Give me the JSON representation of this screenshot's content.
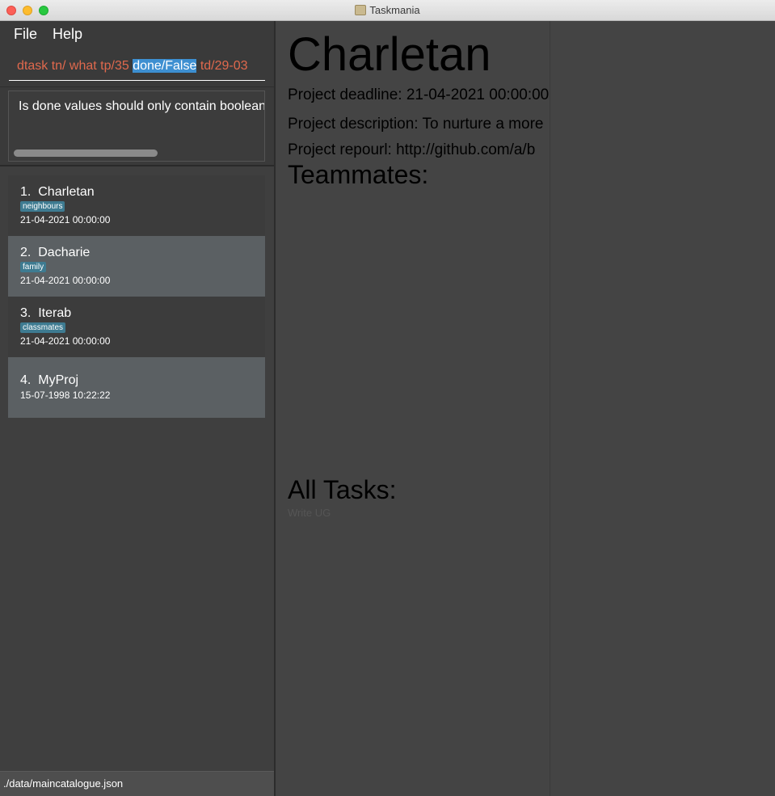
{
  "window": {
    "title": "Taskmania"
  },
  "menu": {
    "file": "File",
    "help": "Help"
  },
  "command": {
    "before": "dtask tn/ what tp/35 ",
    "selected": "done/False",
    "after": " td/29-03"
  },
  "result": {
    "message": "Is done values should only contain boolean values"
  },
  "projects": [
    {
      "index": "1.",
      "name": "Charletan",
      "tag": "neighbours",
      "deadline": "21-04-2021 00:00:00"
    },
    {
      "index": "2.",
      "name": "Dacharie",
      "tag": "family",
      "deadline": "21-04-2021 00:00:00"
    },
    {
      "index": "3.",
      "name": "Iterab",
      "tag": "classmates",
      "deadline": "21-04-2021 00:00:00"
    },
    {
      "index": "4.",
      "name": "MyProj",
      "deadline": "15-07-1998 10:22:22"
    }
  ],
  "status": {
    "path": "./data/maincatalogue.json"
  },
  "detail": {
    "name": "Charletan",
    "deadline": "Project deadline: 21-04-2021 00:00:00",
    "description": "Project description: To nurture a more",
    "repourl": "Project repourl: http://github.com/a/b",
    "teammates_heading": "Teammates:",
    "tasks_heading": "All Tasks:",
    "tasks": [
      "Write UG"
    ]
  }
}
